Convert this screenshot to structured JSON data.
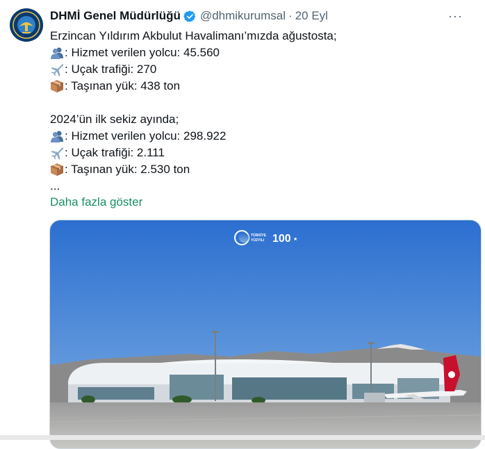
{
  "tweet": {
    "author_name": "DHMİ Genel Müdürlüğü",
    "handle": "@dhmikurumsal",
    "separator": "·",
    "time": "20 Eyl",
    "more_label": "···",
    "lines": [
      {
        "text": "Erzincan Yıldırım Akbulut Havalimanı’mızda ağustosta;",
        "icon": ""
      },
      {
        "text": ": Hizmet verilen yolcu: 45.560",
        "icon": "people-emoji-icon"
      },
      {
        "text": ": Uçak trafiği: 270",
        "icon": "airplane-emoji-icon"
      },
      {
        "text": ": Taşınan yük: 438 ton",
        "icon": "package-emoji-icon"
      },
      {
        "text": "2024’ün ilk sekiz ayında;",
        "icon": ""
      },
      {
        "text": ": Hizmet verilen yolcu: 298.922",
        "icon": "people-emoji-icon"
      },
      {
        "text": ": Uçak trafiği: 2.111",
        "icon": "airplane-emoji-icon"
      },
      {
        "text": ": Taşınan yük: 2.530 ton",
        "icon": "package-emoji-icon"
      },
      {
        "text": "...",
        "icon": ""
      }
    ],
    "show_more_label": "Daha fazla göster",
    "media": {
      "logo_text_top": "TÜRKİYE",
      "logo_text_bottom": "YÜZYILI",
      "logo_100": "100"
    }
  },
  "colors": {
    "link_green": "#1a8f63",
    "secondary_text": "#536471",
    "verified_blue": "#1d9bf0",
    "sky_top": "#2c6fd0",
    "sky_bottom": "#6fa5e0"
  }
}
